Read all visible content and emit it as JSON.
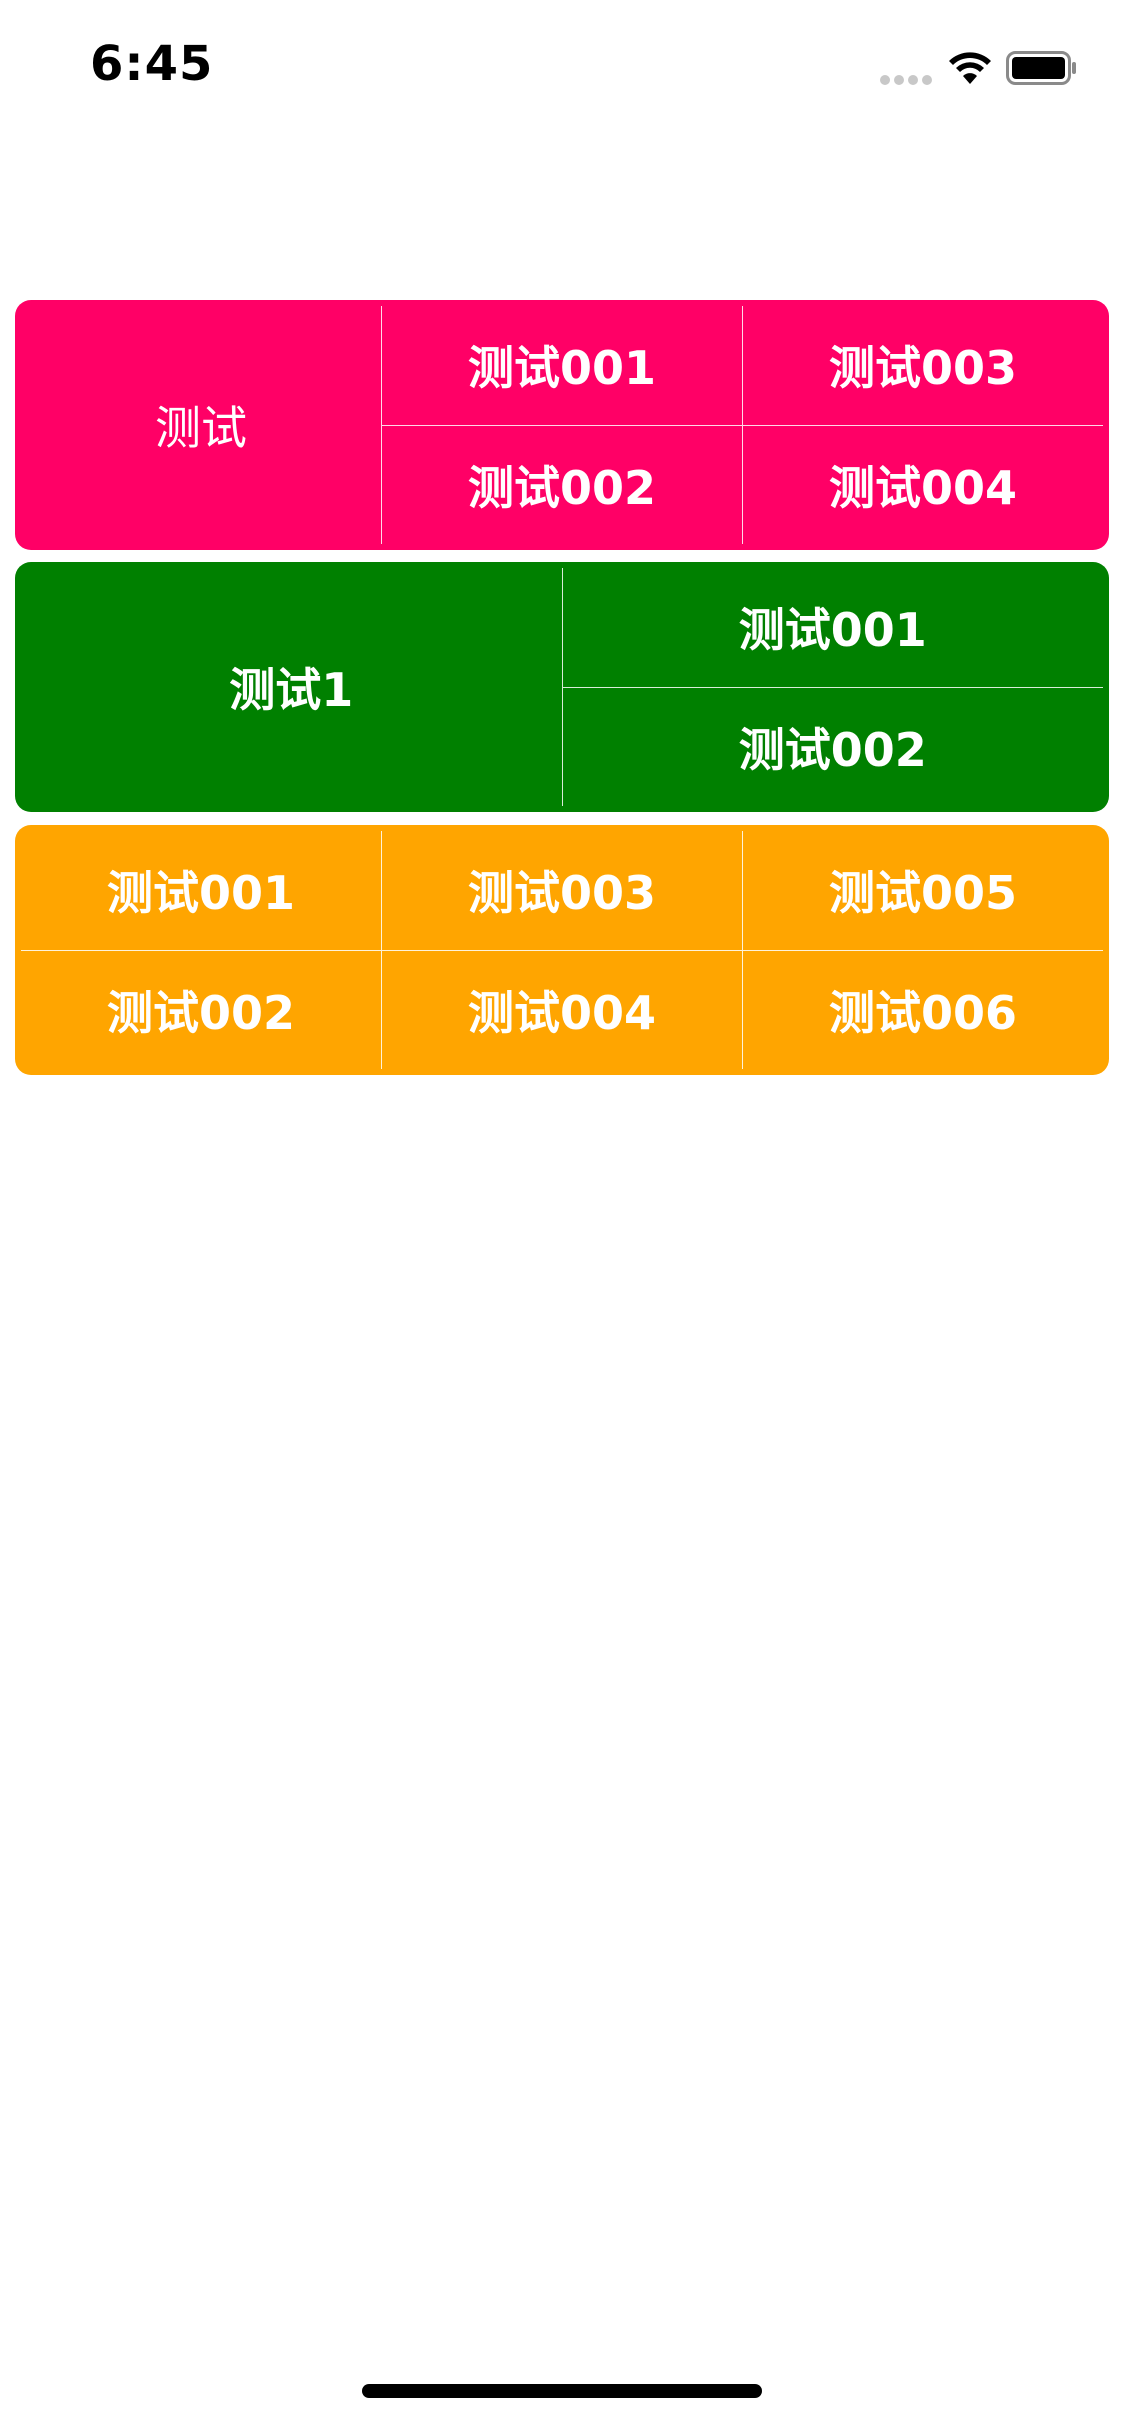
{
  "status_bar": {
    "time": "6:45",
    "icons": [
      "signal-icon",
      "wifi-icon",
      "battery-icon"
    ]
  },
  "colors": {
    "pink": "#FF0066",
    "green": "#008000",
    "orange": "#FFA500",
    "text": "#FFFFFF",
    "divider": "#FFFFFF"
  },
  "card_pink": {
    "main_label": "测试",
    "items": [
      "测试001",
      "测试002",
      "测试003",
      "测试004"
    ]
  },
  "card_green": {
    "main_label": "测试1",
    "items": [
      "测试001",
      "测试002"
    ]
  },
  "card_orange": {
    "items": [
      "测试001",
      "测试002",
      "测试003",
      "测试004",
      "测试005",
      "测试006"
    ]
  }
}
